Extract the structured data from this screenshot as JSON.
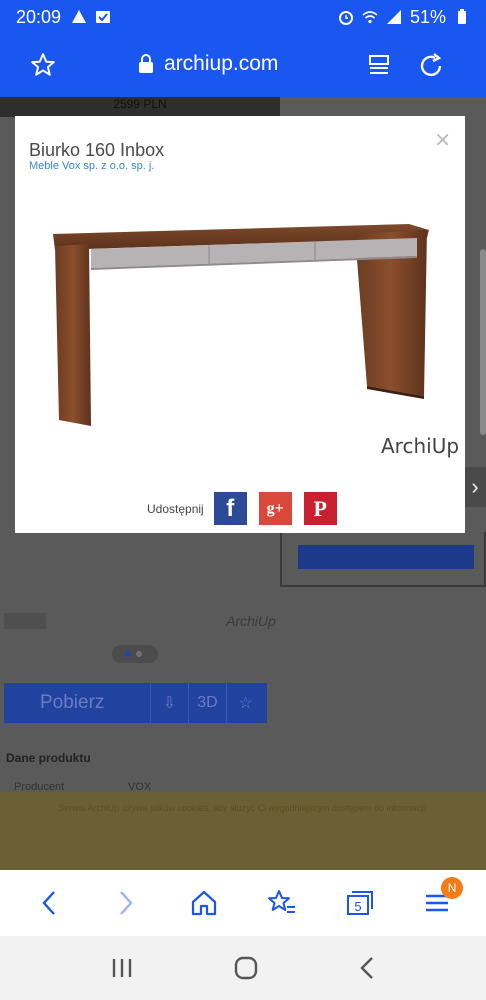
{
  "status_bar": {
    "time": "20:09",
    "battery": "51%"
  },
  "url_bar": {
    "domain": "archiup.com"
  },
  "background_page": {
    "price_strip": "2599 PLN",
    "brand_watermark": "ArchiUp",
    "download_label": "Pobierz",
    "three_d_label": "3D",
    "section_title": "Dane produktu",
    "producer_label": "Producent",
    "producer_value": "VOX",
    "cookie_text": "Serwis ArchiUp używa plików cookies, aby służyć Ci wygodniejszym dostępem do informacji."
  },
  "modal": {
    "title": "Biurko 160 Inbox",
    "subtitle": "Meble Vox sp. z o.o. sp. j.",
    "brand": "ArchiUp",
    "share_label": "Udostępnij",
    "social": {
      "facebook": "f",
      "google_plus": "g+",
      "pinterest": "P"
    }
  },
  "browser_nav": {
    "tabs_count": "5",
    "menu_badge": "N"
  },
  "colors": {
    "accent": "#1a56f0",
    "facebook": "#2d4a96",
    "google_plus": "#d9493b",
    "pinterest": "#c8202f",
    "badge": "#f27c18"
  }
}
